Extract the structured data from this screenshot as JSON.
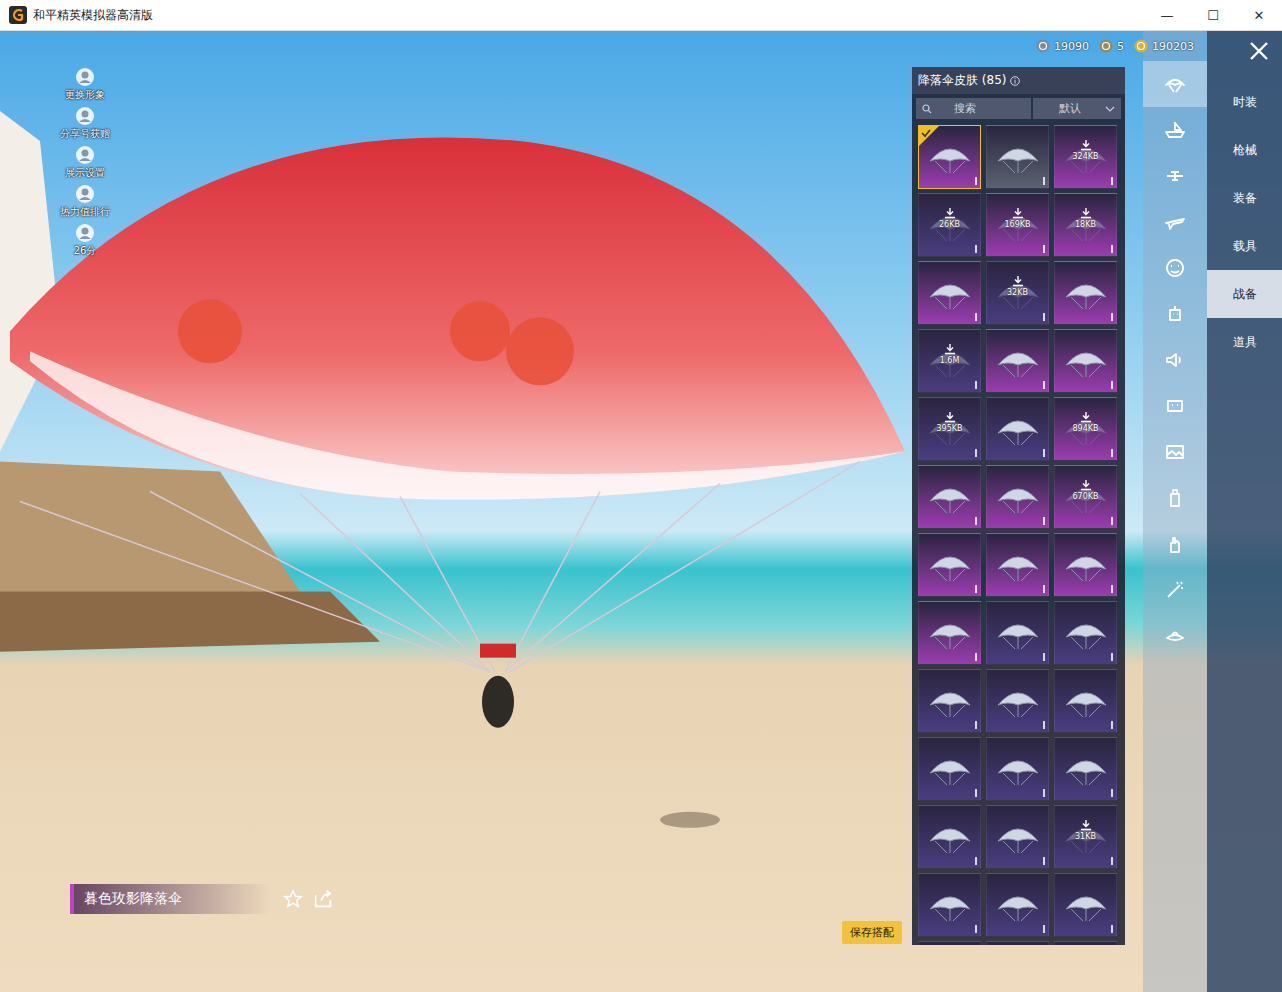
{
  "window": {
    "title": "和平精英模拟器高清版",
    "controls": [
      "—",
      "☐",
      "✕"
    ]
  },
  "side_actions": [
    {
      "label": "更换形象"
    },
    {
      "label": "分享号获赠"
    },
    {
      "label": "展示设置"
    },
    {
      "label": "热力值排行"
    },
    {
      "label": "26分"
    }
  ],
  "currencies": [
    {
      "value": "19090",
      "color": "#7d8a9c"
    },
    {
      "value": "5",
      "color": "#9a8a5a"
    },
    {
      "value": "190203",
      "color": "#e0b030"
    }
  ],
  "panel": {
    "title": "降落伞皮肤 (85)",
    "search_placeholder": "搜索",
    "sort": "默认"
  },
  "items": [
    {
      "kind": "owned",
      "selected": true,
      "color": "#9b3db0"
    },
    {
      "kind": "owned",
      "selected": false,
      "color": "#5a6270"
    },
    {
      "kind": "download",
      "size": "324KB",
      "selected": false,
      "color": "#9b3db0"
    },
    {
      "kind": "download",
      "size": "26KB",
      "selected": false,
      "color": "#4a3d80"
    },
    {
      "kind": "download",
      "size": "169KB",
      "selected": false,
      "color": "#9b3db0"
    },
    {
      "kind": "download",
      "size": "18KB",
      "selected": false,
      "color": "#9b3db0"
    },
    {
      "kind": "owned",
      "selected": false,
      "color": "#9b3db0"
    },
    {
      "kind": "download",
      "size": "32KB",
      "selected": false,
      "color": "#4a3d80"
    },
    {
      "kind": "owned",
      "selected": false,
      "color": "#9b3db0"
    },
    {
      "kind": "download",
      "size": "1.6M",
      "selected": false,
      "color": "#4a3d80"
    },
    {
      "kind": "owned",
      "selected": false,
      "color": "#9b3db0"
    },
    {
      "kind": "owned",
      "selected": false,
      "color": "#9b3db0"
    },
    {
      "kind": "download",
      "size": "395KB",
      "selected": false,
      "color": "#4a3d80"
    },
    {
      "kind": "owned",
      "selected": false,
      "color": "#4a3d80"
    },
    {
      "kind": "download",
      "size": "894KB",
      "selected": false,
      "color": "#9b3db0"
    },
    {
      "kind": "owned",
      "selected": false,
      "color": "#9b3db0"
    },
    {
      "kind": "owned",
      "selected": false,
      "color": "#9b3db0"
    },
    {
      "kind": "download",
      "size": "670KB",
      "selected": false,
      "color": "#9b3db0"
    },
    {
      "kind": "owned",
      "selected": false,
      "color": "#9b3db0"
    },
    {
      "kind": "owned",
      "selected": false,
      "color": "#9b3db0"
    },
    {
      "kind": "owned",
      "selected": false,
      "color": "#9b3db0"
    },
    {
      "kind": "owned",
      "selected": false,
      "color": "#9b3db0"
    },
    {
      "kind": "owned",
      "selected": false,
      "color": "#4a3d80"
    },
    {
      "kind": "owned",
      "selected": false,
      "color": "#4a3d80"
    },
    {
      "kind": "owned",
      "selected": false,
      "color": "#4a3d80"
    },
    {
      "kind": "owned",
      "selected": false,
      "color": "#4a3d80"
    },
    {
      "kind": "owned",
      "selected": false,
      "color": "#4a3d80"
    },
    {
      "kind": "owned",
      "selected": false,
      "color": "#4a3d80"
    },
    {
      "kind": "owned",
      "selected": false,
      "color": "#4a3d80"
    },
    {
      "kind": "owned",
      "selected": false,
      "color": "#4a3d80"
    },
    {
      "kind": "owned",
      "selected": false,
      "color": "#4a3d80"
    },
    {
      "kind": "owned",
      "selected": false,
      "color": "#4a3d80"
    },
    {
      "kind": "download",
      "size": "31KB",
      "selected": false,
      "color": "#4a3d80"
    },
    {
      "kind": "owned",
      "selected": false,
      "color": "#4a3d80"
    },
    {
      "kind": "owned",
      "selected": false,
      "color": "#4a3d80"
    },
    {
      "kind": "owned",
      "selected": false,
      "color": "#4a3d80"
    },
    {
      "kind": "owned",
      "selected": false,
      "color": "#4a3d80"
    },
    {
      "kind": "owned",
      "selected": false,
      "color": "#4a3d80"
    },
    {
      "kind": "owned",
      "selected": false,
      "color": "#4a3d80"
    }
  ],
  "icon_tabs": [
    {
      "selected": true
    },
    {
      "selected": false
    },
    {
      "selected": false
    },
    {
      "selected": false
    },
    {
      "selected": false
    },
    {
      "selected": false
    },
    {
      "selected": false
    },
    {
      "selected": false
    },
    {
      "selected": false
    },
    {
      "selected": false
    },
    {
      "selected": false
    },
    {
      "selected": false
    },
    {
      "selected": false
    }
  ],
  "categories": [
    {
      "label": "时装",
      "selected": false
    },
    {
      "label": "枪械",
      "selected": false
    },
    {
      "label": "装备",
      "selected": false
    },
    {
      "label": "载具",
      "selected": false
    },
    {
      "label": "战备",
      "selected": true
    },
    {
      "label": "道具",
      "selected": false
    }
  ],
  "selected_item": {
    "name": "暮色玫影降落伞",
    "favorited": false
  },
  "save_button": "保存搭配"
}
